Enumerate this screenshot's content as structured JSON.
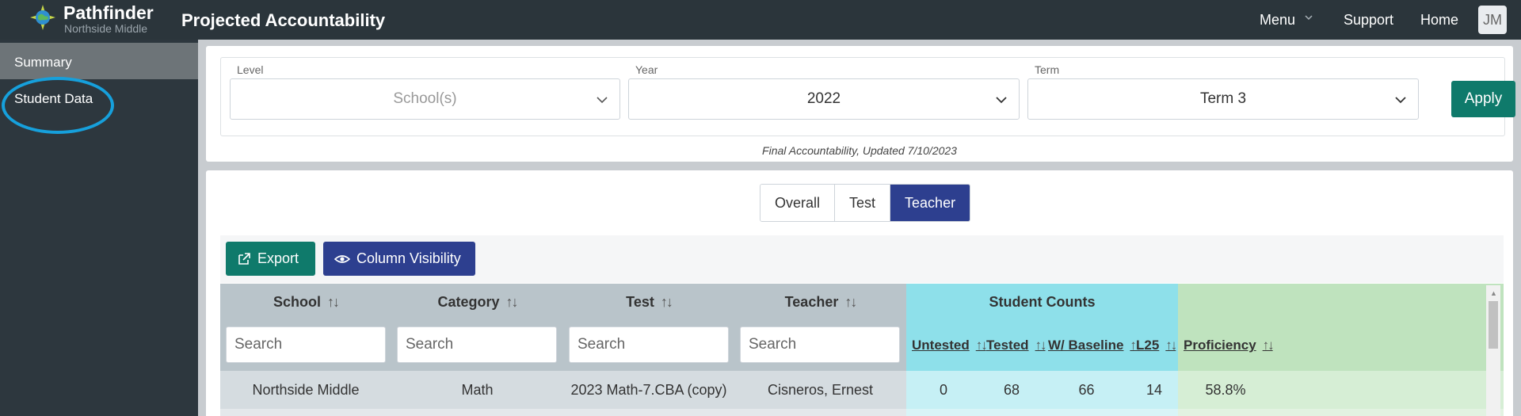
{
  "topbar": {
    "brand_name": "Pathfinder",
    "brand_sub": "Northside Middle",
    "app_title": "Projected Accountability",
    "nav": {
      "menu": "Menu",
      "support": "Support",
      "home": "Home"
    },
    "avatar_initials": "JM"
  },
  "sidebar": {
    "items": [
      {
        "label": "Summary"
      },
      {
        "label": "Student Data"
      }
    ]
  },
  "filters": {
    "level": {
      "label": "Level",
      "placeholder": "School(s)"
    },
    "year": {
      "label": "Year",
      "value": "2022"
    },
    "term": {
      "label": "Term",
      "value": "Term 3"
    },
    "apply": "Apply",
    "note": "Final Accountability, Updated 7/10/2023"
  },
  "tabs": [
    {
      "label": "Overall",
      "active": false
    },
    {
      "label": "Test",
      "active": false
    },
    {
      "label": "Teacher",
      "active": true
    }
  ],
  "toolbar": {
    "export": "Export",
    "column_visibility": "Column Visibility"
  },
  "table": {
    "headers": {
      "school": "School",
      "category": "Category",
      "test": "Test",
      "teacher": "Teacher",
      "student_counts": "Student Counts"
    },
    "sub_headers": {
      "untested": "Untested",
      "tested": "Tested",
      "w_baseline": "W/ Baseline",
      "l25": "L25",
      "proficiency": "Proficiency"
    },
    "search_placeholder": "Search",
    "rows": [
      {
        "school": "Northside Middle",
        "category": "Math",
        "test": "2023 Math-7.CBA (copy)",
        "teacher": "Cisneros, Ernest",
        "untested": "0",
        "tested": "68",
        "w_baseline": "66",
        "l25": "14",
        "proficiency": "58.8%"
      }
    ]
  },
  "colors": {
    "topbar": "#2b353b",
    "accent_green": "#0f7a6b",
    "accent_blue": "#2d3f8f",
    "annotation": "#16a0dc"
  }
}
